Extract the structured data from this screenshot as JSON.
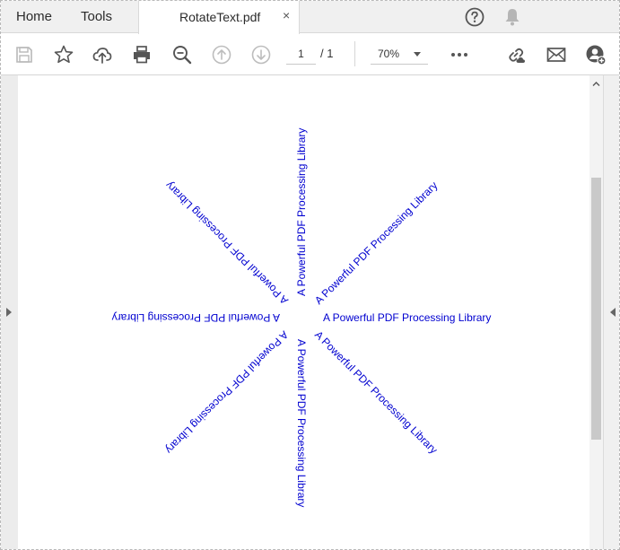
{
  "tabs": {
    "home": "Home",
    "tools": "Tools",
    "document": "RotateText.pdf",
    "close": "×"
  },
  "toolbar": {
    "page_current": "1",
    "page_total": "/ 1",
    "zoom": "70%"
  },
  "icons": {
    "help": "help-icon",
    "bell": "bell-icon",
    "save": "save-icon",
    "star": "star-icon",
    "upload": "cloud-upload-icon",
    "print": "print-icon",
    "zoom_out": "zoom-out-icon",
    "prev": "arrow-up-icon",
    "next": "arrow-down-icon",
    "more": "more-icon",
    "share_link": "link-cloud-icon",
    "mail": "mail-icon",
    "add_user": "add-user-icon"
  },
  "document": {
    "text": "A Powerful PDF Processing Library",
    "rotations": [
      0,
      45,
      90,
      135,
      180,
      225,
      270,
      315
    ],
    "color": "#0000D0"
  }
}
